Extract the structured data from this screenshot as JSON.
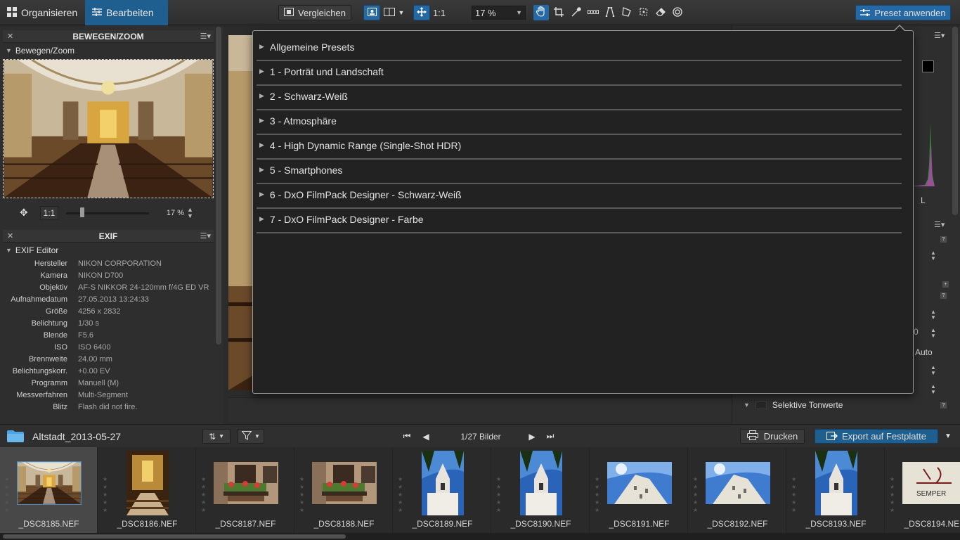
{
  "toolbar": {
    "organize_label": "Organisieren",
    "edit_label": "Bearbeiten",
    "compare_label": "Vergleichen",
    "one_to_one": "1:1",
    "zoom_value": "17 %",
    "preset_label": "Preset anwenden"
  },
  "left_panel": {
    "move_zoom_header": "BEWEGEN/ZOOM",
    "move_zoom_sub": "Bewegen/Zoom",
    "nav_one_to_one": "1:1",
    "nav_zoom": "17 %",
    "exif_header": "EXIF",
    "exif_sub": "EXIF Editor",
    "exif": [
      {
        "k": "Hersteller",
        "v": "NIKON CORPORATION"
      },
      {
        "k": "Kamera",
        "v": "NIKON D700"
      },
      {
        "k": "Objektiv",
        "v": "AF-S NIKKOR 24-120mm f/4G ED VR"
      },
      {
        "k": "Aufnahmedatum",
        "v": "27.05.2013 13:24:33"
      },
      {
        "k": "Größe",
        "v": "4256 x 2832"
      },
      {
        "k": "Belichtung",
        "v": "1/30 s"
      },
      {
        "k": "Blende",
        "v": "F5.6"
      },
      {
        "k": "ISO",
        "v": "ISO 6400"
      },
      {
        "k": "Brennweite",
        "v": "24.00 mm"
      },
      {
        "k": "Belichtungskorr.",
        "v": "+0.00 EV"
      },
      {
        "k": "Programm",
        "v": "Manuell (M)"
      },
      {
        "k": "Messverfahren",
        "v": "Multi-Segment"
      },
      {
        "k": "Blitz",
        "v": "Flash did not fire."
      }
    ]
  },
  "presets": {
    "items": [
      "Allgemeine Presets",
      "1 - Porträt und Landschaft",
      "2 - Schwarz-Weiß",
      "3 - Atmosphäre",
      "4 - High Dynamic Range (Single-Shot HDR)",
      "5 - Smartphones",
      "6 - DxO FilmPack Designer - Schwarz-Weiß",
      "7 - DxO FilmPack Designer - Farbe"
    ]
  },
  "right_panel": {
    "l_label": "L",
    "auto_label": "Auto",
    "zero_label": "0",
    "selective_label": "Selektive Tonwerte"
  },
  "filmstrip": {
    "folder": "Altstadt_2013-05-27",
    "count": "1/27 Bilder",
    "print_label": "Drucken",
    "export_label": "Export auf Festplatte",
    "thumbs": [
      "_DSC8185.NEF",
      "_DSC8186.NEF",
      "_DSC8187.NEF",
      "_DSC8188.NEF",
      "_DSC8189.NEF",
      "_DSC8190.NEF",
      "_DSC8191.NEF",
      "_DSC8192.NEF",
      "_DSC8193.NEF",
      "_DSC8194.NEF"
    ]
  },
  "colors": {
    "accent": "#2469a3",
    "panel": "#2e2e2e",
    "popup": "#222222"
  }
}
